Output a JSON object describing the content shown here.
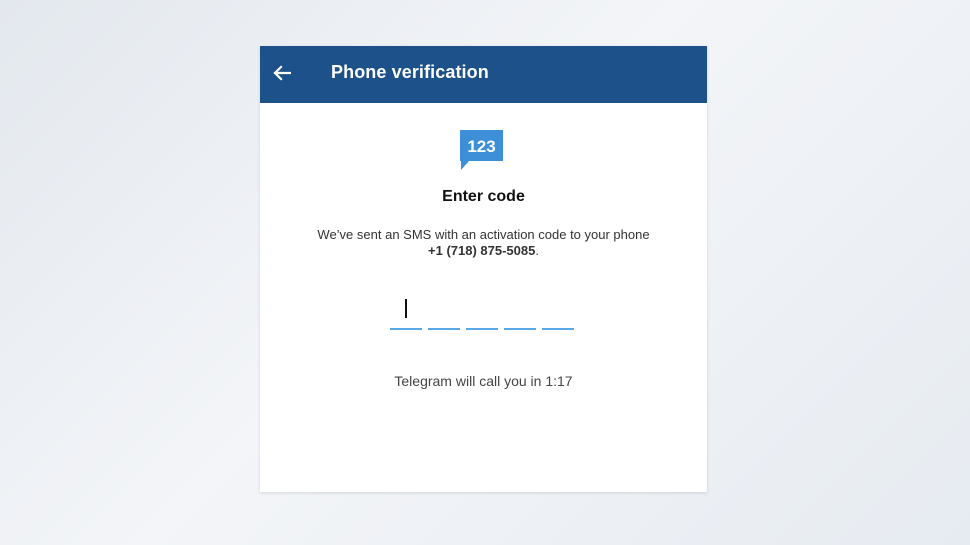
{
  "app_bar": {
    "title": "Phone verification",
    "back_icon": "arrow-left-icon",
    "color": "#1c5189"
  },
  "badge": {
    "icon": "sms-code-badge-icon",
    "text": "123",
    "color": "#3d8fd8"
  },
  "heading": "Enter code",
  "message": {
    "text": "We’ve sent an SMS with an activation code to your phone",
    "phone": "+1 (718) 875-5085",
    "suffix": "."
  },
  "code_input": {
    "digits": [
      "",
      "",
      "",
      "",
      ""
    ],
    "active_index": 0,
    "underline_color": "#5aa9e6"
  },
  "call_timer": "Telegram will call you in 1:17"
}
